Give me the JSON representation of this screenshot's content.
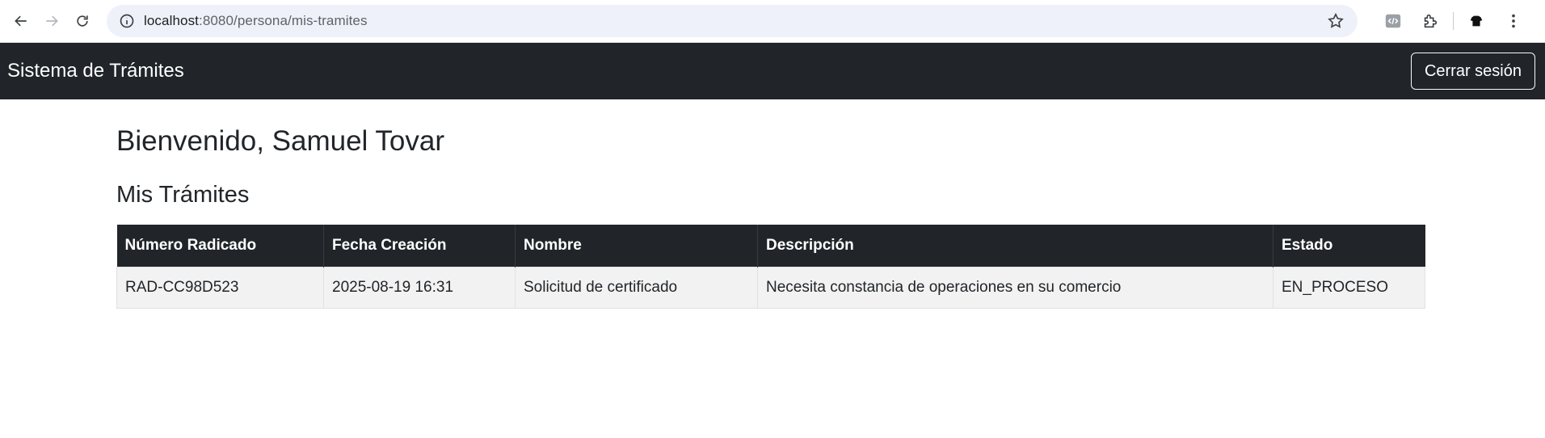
{
  "browser": {
    "url_host": "localhost",
    "url_path": ":8080/persona/mis-tramites"
  },
  "navbar": {
    "brand": "Sistema de Trámites",
    "logout_label": "Cerrar sesión"
  },
  "main": {
    "welcome": "Bienvenido, Samuel Tovar",
    "section_title": "Mis Trámites",
    "table": {
      "headers": [
        "Número Radicado",
        "Fecha Creación",
        "Nombre",
        "Descripción",
        "Estado"
      ],
      "rows": [
        [
          "RAD-CC98D523",
          "2025-08-19 16:31",
          "Solicitud de certificado",
          "Necesita constancia de operaciones en su comercio",
          "EN_PROCESO"
        ]
      ]
    }
  },
  "colors": {
    "navbar_bg": "#212529",
    "row_bg": "#f2f2f2"
  }
}
